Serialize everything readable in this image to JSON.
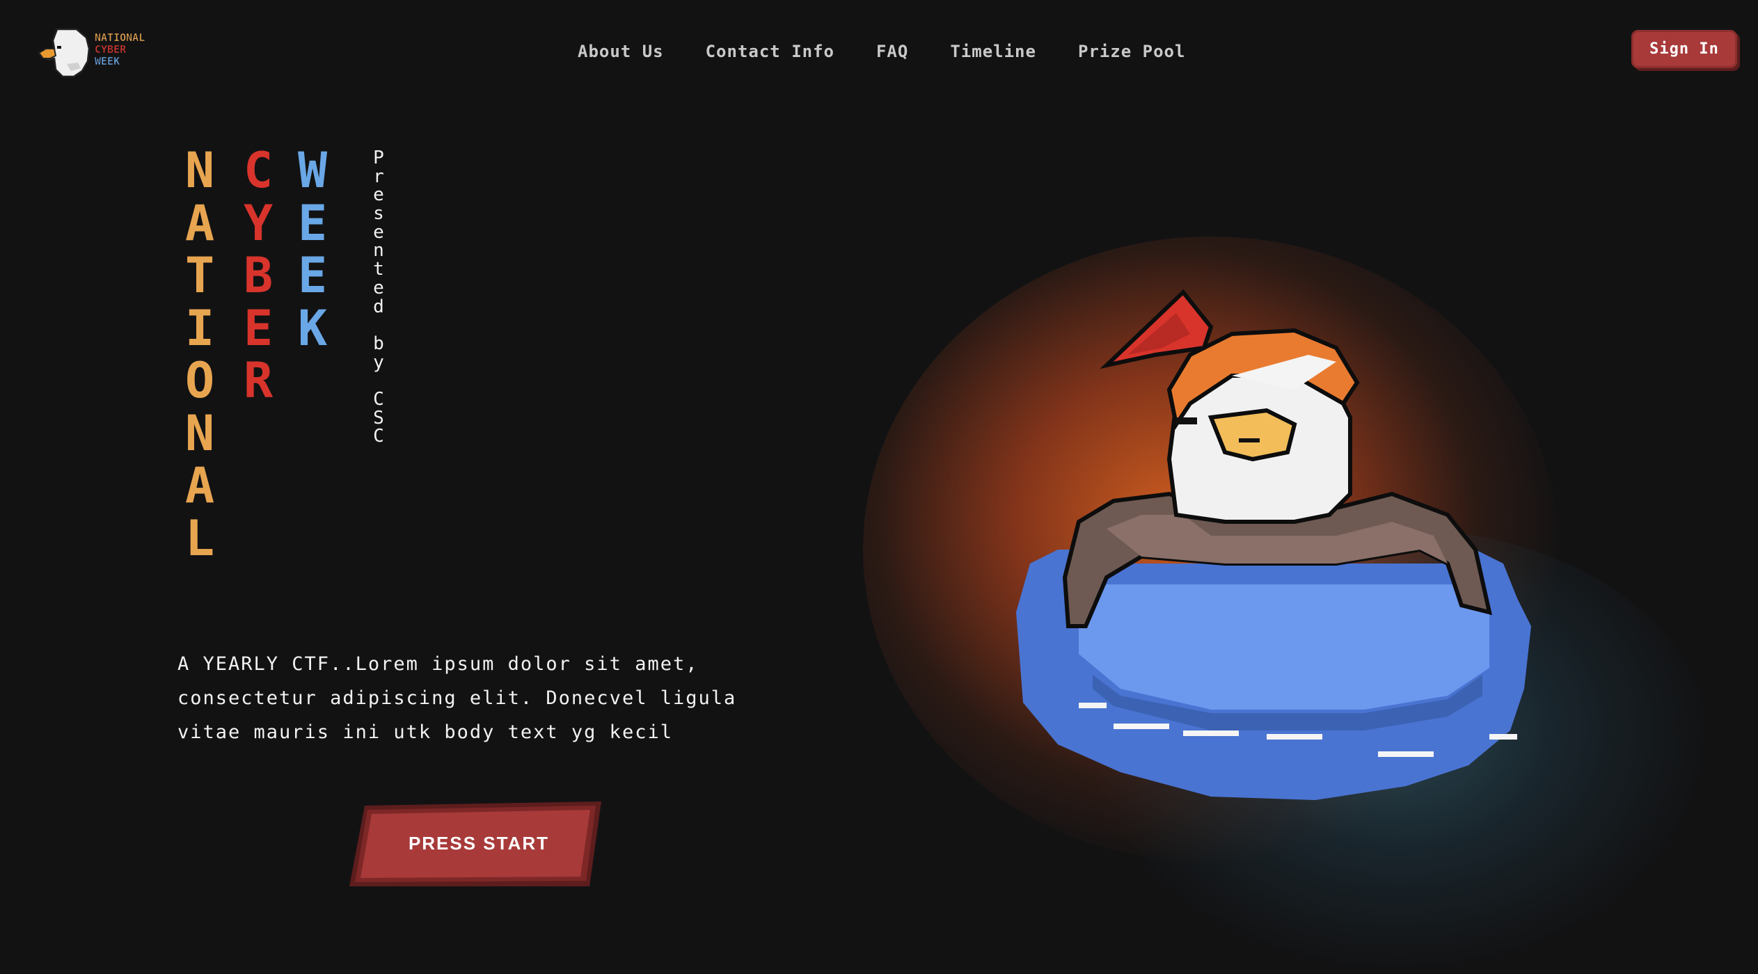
{
  "logo": {
    "lines": [
      "NATIONAL",
      "CYBER",
      "WEEK"
    ],
    "icon": "eagle-head-icon"
  },
  "nav": {
    "items": [
      "About Us",
      "Contact Info",
      "FAQ",
      "Timeline",
      "Prize Pool"
    ]
  },
  "header": {
    "signin_label": "Sign In"
  },
  "hero": {
    "title_columns": [
      {
        "word": "NATIONAL",
        "color": "#e8a550"
      },
      {
        "word": "CYBER",
        "color": "#d8342c"
      },
      {
        "word": "WEEK",
        "color": "#6aa7e6"
      }
    ],
    "presented_by": "Presented by CSC",
    "description_lines": [
      "A YEARLY CTF..Lorem ipsum dolor sit amet,",
      "consectetur adipiscing elit. Donecvel ligula",
      "vitae mauris ini utk body text yg kecil"
    ],
    "cta_label": "PRESS START"
  },
  "mascot": {
    "icon": "eagle-in-swim-ring-icon",
    "colors": {
      "ring": "#4f7fd6",
      "hat": "#d8342c",
      "glow": "#d6602a"
    }
  }
}
